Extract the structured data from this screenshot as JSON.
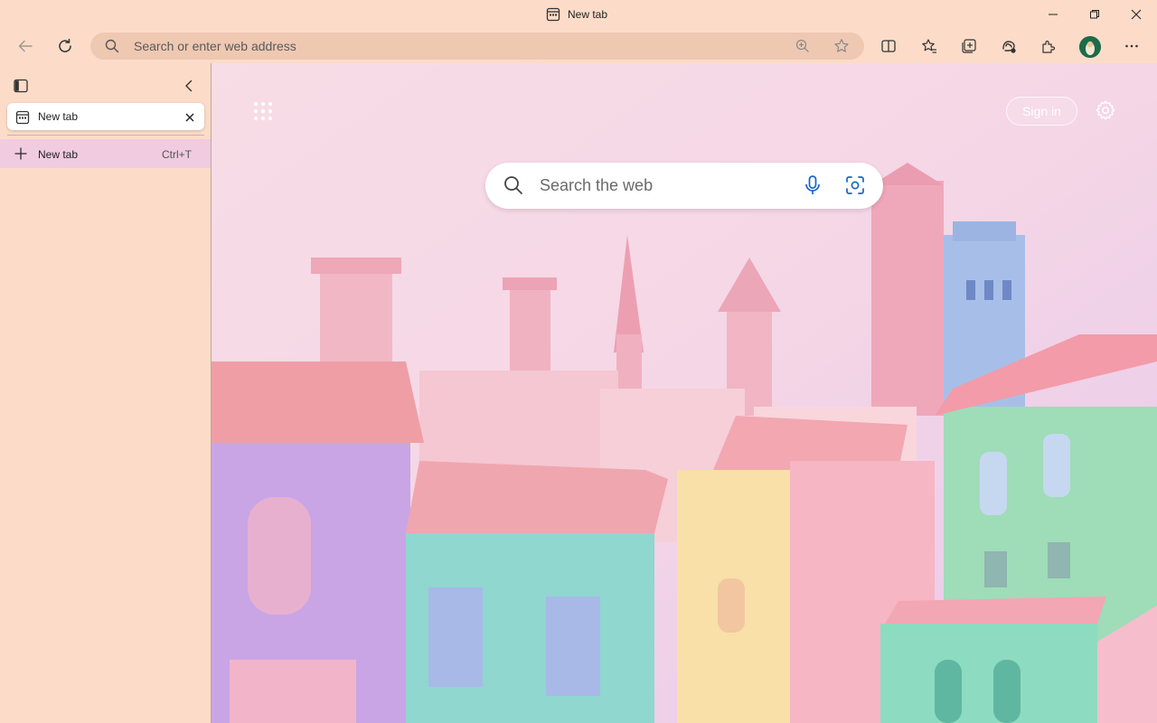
{
  "window": {
    "title": "New tab",
    "controls": [
      "minimize",
      "restore",
      "close"
    ]
  },
  "toolbar": {
    "address_placeholder": "Search or enter web address",
    "icons": [
      "back-icon",
      "refresh-icon",
      "split-screen-icon",
      "favorites-icon",
      "collections-icon",
      "copilot-icon",
      "extensions-icon",
      "profile-avatar",
      "more-icon"
    ]
  },
  "sidebar": {
    "tabs": [
      {
        "title": "New tab",
        "active": true
      }
    ],
    "new_tab_label": "New tab",
    "new_tab_shortcut": "Ctrl+T"
  },
  "newtab_page": {
    "search_placeholder": "Search the web",
    "signin_label": "Sign in"
  },
  "colors": {
    "chrome_bg": "#fcdcc8",
    "address_bg": "#efc8b2",
    "newtab_row_bg": "#f1cbe0"
  }
}
